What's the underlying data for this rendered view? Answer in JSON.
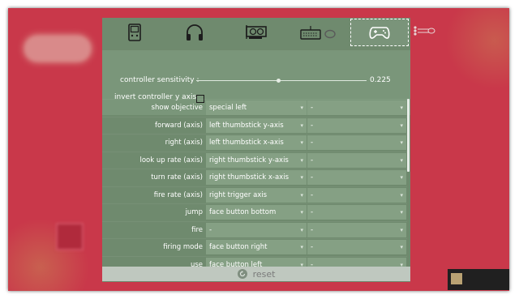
{
  "background_menu": {
    "logo_text": "",
    "items": [
      "",
      "",
      "",
      ""
    ]
  },
  "tabs": [
    {
      "name": "display",
      "icon": "handheld-console-icon"
    },
    {
      "name": "audio",
      "icon": "headphones-icon"
    },
    {
      "name": "graphics",
      "icon": "graphics-card-icon"
    },
    {
      "name": "keyboard-mouse",
      "icon": "keyboard-mouse-icon"
    },
    {
      "name": "controller",
      "icon": "gamepad-icon",
      "active": true
    }
  ],
  "controller": {
    "sensitivity_label": "controller sensitivity :",
    "sensitivity_value": "0.225",
    "sensitivity_fraction": 0.48,
    "invert_label": "invert controller y axis :",
    "invert_checked": false
  },
  "bindings": [
    {
      "action": "show objective",
      "primary": "special left",
      "secondary": "-"
    },
    {
      "action": "forward (axis)",
      "primary": "left thumbstick y-axis",
      "secondary": "-"
    },
    {
      "action": "right (axis)",
      "primary": "left thumbstick x-axis",
      "secondary": "-"
    },
    {
      "action": "look up rate (axis)",
      "primary": "right thumbstick y-axis",
      "secondary": "-"
    },
    {
      "action": "turn rate (axis)",
      "primary": "right thumbstick x-axis",
      "secondary": "-"
    },
    {
      "action": "fire rate (axis)",
      "primary": "right trigger axis",
      "secondary": "-"
    },
    {
      "action": "jump",
      "primary": "face button bottom",
      "secondary": "-"
    },
    {
      "action": "fire",
      "primary": "-",
      "secondary": "-"
    },
    {
      "action": "firing mode",
      "primary": "face button right",
      "secondary": "-"
    },
    {
      "action": "use",
      "primary": "face button left",
      "secondary": "-"
    }
  ],
  "dropdown_arrow": "▾",
  "reset_label": "reset",
  "toast": {
    "title": "",
    "line1": "",
    "line2": ""
  },
  "colors": {
    "background": "#c9384a",
    "panel": "#6f8a6e",
    "dropdown": "#85a084",
    "reset_bar": "#bfc8bf"
  }
}
